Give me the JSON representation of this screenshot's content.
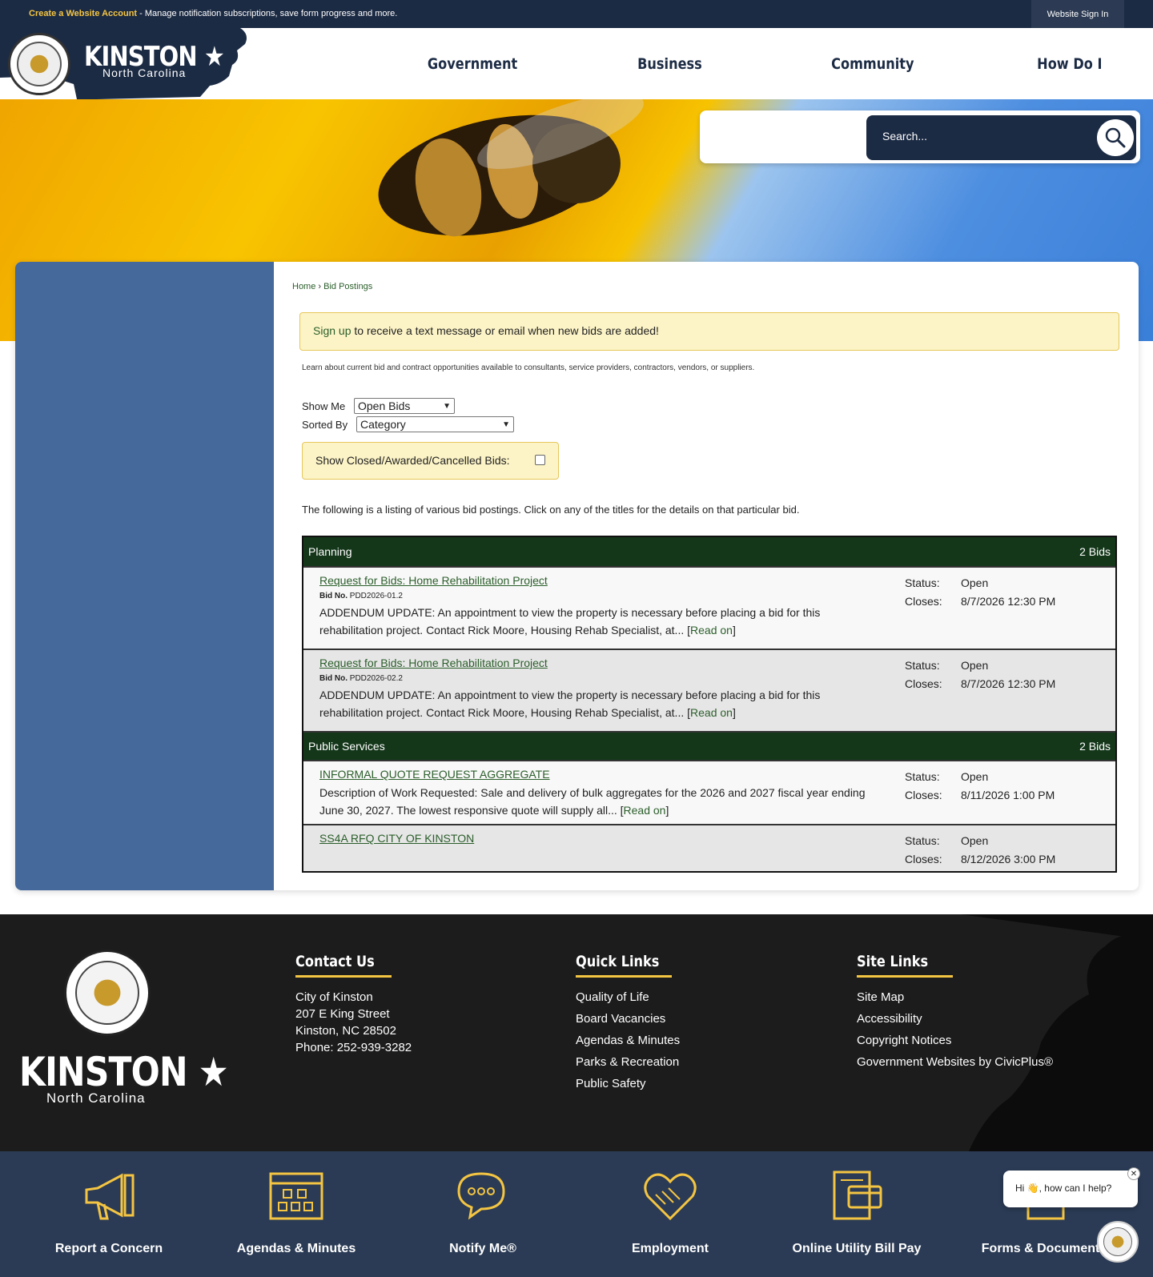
{
  "topbar": {
    "account_link": "Create a Website Account",
    "message": " - Manage notification subscriptions, save form progress and more.",
    "signin": "Website Sign In"
  },
  "logo": {
    "title": "KINSTON",
    "subtitle": "North Carolina"
  },
  "nav": [
    "Government",
    "Business",
    "Community",
    "How Do I"
  ],
  "search": {
    "placeholder": "Search..."
  },
  "breadcrumb": {
    "home": "Home",
    "sep": " › ",
    "current": "Bid Postings"
  },
  "alert": {
    "link": "Sign up",
    "text": " to receive a text message or email when new bids are added!"
  },
  "learn": "Learn about current bid and contract opportunities available to consultants, service providers, contractors, vendors, or suppliers.",
  "filters": {
    "show_me_label": "Show Me",
    "show_me_value": "Open Bids",
    "sorted_by_label": "Sorted By",
    "sorted_by_value": "Category",
    "closed_label": "Show Closed/Awarded/Cancelled Bids:"
  },
  "listing_text": "The following is a listing of various bid postings. Click on any of the titles for the details on that particular bid.",
  "categories": [
    {
      "name": "Planning",
      "count": "2 Bids",
      "bids": [
        {
          "title": "Request for Bids: Home Rehabilitation Project",
          "bid_no_label": "Bid No.",
          "bid_no": "PDD2026-01.2",
          "desc": "ADDENDUM UPDATE: An appointment to view the property is necessary before placing a bid for this rehabilitation project. Contact Rick Moore, Housing Rehab Specialist, at... ",
          "read_on": "Read on",
          "status_label": "Status:",
          "status": "Open",
          "closes_label": "Closes:",
          "closes": "8/7/2026 12:30 PM"
        },
        {
          "title": "Request for Bids: Home Rehabilitation Project",
          "bid_no_label": "Bid No.",
          "bid_no": "PDD2026-02.2",
          "desc": "ADDENDUM UPDATE: An appointment to view the property is necessary before placing a bid for this rehabilitation project. Contact Rick Moore, Housing Rehab Specialist, at... ",
          "read_on": "Read on",
          "status_label": "Status:",
          "status": "Open",
          "closes_label": "Closes:",
          "closes": "8/7/2026 12:30 PM"
        }
      ]
    },
    {
      "name": "Public Services",
      "count": "2 Bids",
      "bids": [
        {
          "title": "INFORMAL QUOTE REQUEST AGGREGATE",
          "desc": "Description of Work Requested: Sale and delivery of bulk aggregates for the 2026 and 2027 fiscal year ending June 30, 2027. The lowest responsive quote will supply all... ",
          "read_on": "Read on",
          "status_label": "Status:",
          "status": "Open",
          "closes_label": "Closes:",
          "closes": "8/11/2026 1:00 PM"
        },
        {
          "title": "SS4A RFQ CITY OF KINSTON",
          "status_label": "Status:",
          "status": "Open",
          "closes_label": "Closes:",
          "closes": "8/12/2026 3:00 PM"
        }
      ]
    }
  ],
  "footer": {
    "logo_title": "KINSTON",
    "logo_subtitle": "North Carolina",
    "contact": {
      "heading": "Contact Us",
      "lines": [
        "City of Kinston",
        "207 E King Street",
        "Kinston, NC 28502",
        "Phone: 252-939-3282"
      ]
    },
    "quick_links": {
      "heading": "Quick Links",
      "items": [
        "Quality of Life",
        "Board Vacancies",
        "Agendas & Minutes",
        "Parks & Recreation",
        "Public Safety"
      ]
    },
    "site_links": {
      "heading": "Site Links",
      "items": [
        "Site Map",
        "Accessibility",
        "Copyright Notices",
        "Government Websites by CivicPlus®"
      ]
    }
  },
  "iconbar": [
    {
      "label": "Report a Concern",
      "icon": "megaphone-icon"
    },
    {
      "label": "Agendas & Minutes",
      "icon": "calendar-icon"
    },
    {
      "label": "Notify Me®",
      "icon": "chat-bubbles-icon"
    },
    {
      "label": "Employment",
      "icon": "handshake-heart-icon"
    },
    {
      "label": "Online Utility Bill Pay",
      "icon": "bill-pay-icon"
    },
    {
      "label": "Forms & Documents",
      "icon": "documents-icon"
    }
  ],
  "chat": {
    "greeting": "Hi 👋, how can I help?",
    "close": "✕"
  },
  "colors": {
    "navy": "#1c2b44",
    "accent_yellow": "#f4c542",
    "category_green": "#14371a",
    "link_green": "#2b5e2b",
    "sidebar_blue": "#44699a"
  }
}
